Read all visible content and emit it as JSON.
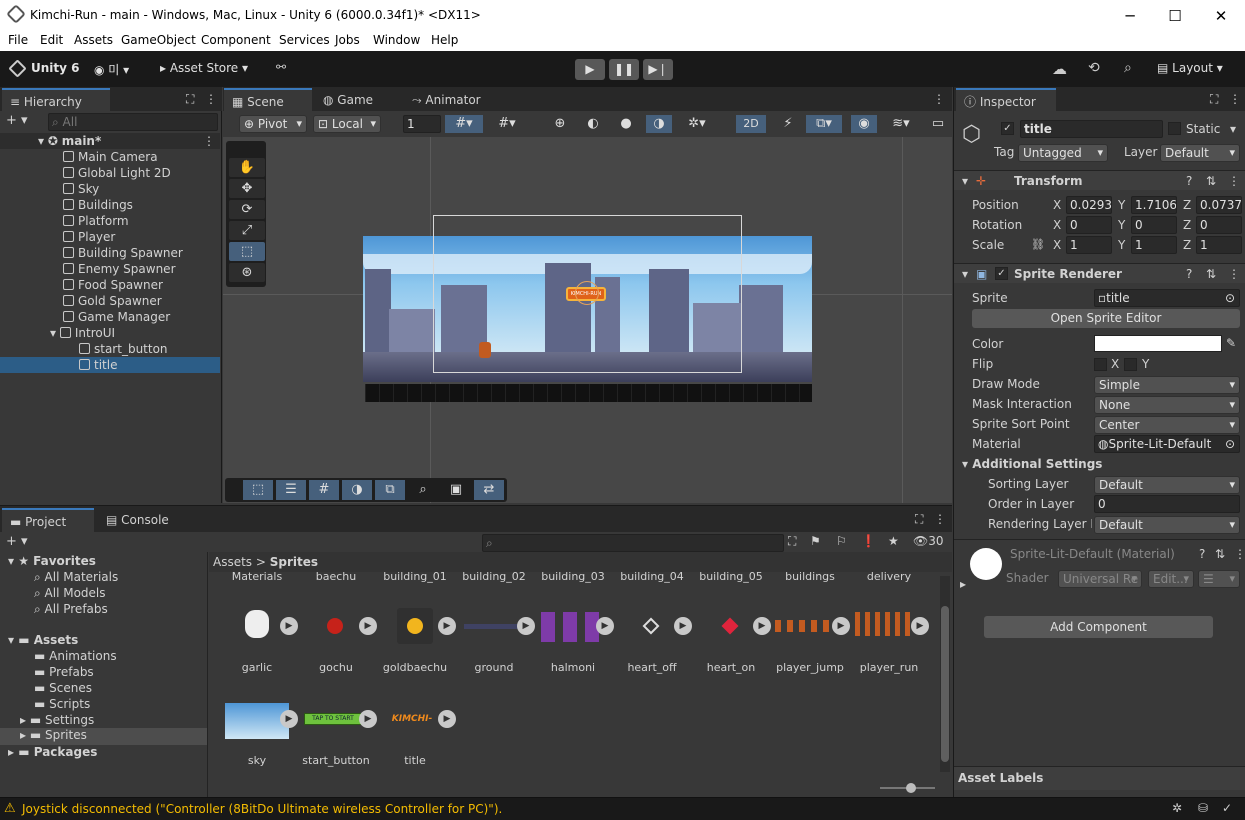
{
  "window": {
    "title": "Kimchi-Run - main - Windows, Mac, Linux - Unity 6 (6000.0.34f1)* <DX11>",
    "minimize": "─",
    "maximize": "☐",
    "close": "✕"
  },
  "menu": [
    "File",
    "Edit",
    "Assets",
    "GameObject",
    "Component",
    "Services",
    "Jobs",
    "Window",
    "Help"
  ],
  "toolbar": {
    "brand": "Unity 6",
    "account": "미",
    "asset_store": "Asset Store",
    "layout": "Layout"
  },
  "hierarchy": {
    "tab": "Hierarchy",
    "search_placeholder": "All",
    "scene": "main*",
    "items": [
      "Main Camera",
      "Global Light 2D",
      "Sky",
      "Buildings",
      "Platform",
      "Player",
      "Building Spawner",
      "Enemy Spawner",
      "Food Spawner",
      "Gold Spawner",
      "Game Manager",
      "IntroUI",
      "start_button",
      "title"
    ]
  },
  "scene": {
    "tabs": [
      "Scene",
      "Game",
      "Animator"
    ],
    "pivot": "Pivot",
    "local": "Local",
    "grid_value": "1",
    "mode_2d": "2D",
    "title_sprite_text": "KIMCHI-RUN"
  },
  "project": {
    "tabs": [
      "Project",
      "Console"
    ],
    "breadcrumb_root": "Assets",
    "breadcrumb_current": "Sprites",
    "count": "30",
    "favorites_label": "Favorites",
    "favorites": [
      "All Materials",
      "All Models",
      "All Prefabs"
    ],
    "assets_label": "Assets",
    "folders": [
      "Animations",
      "Prefabs",
      "Scenes",
      "Scripts",
      "Settings",
      "Sprites"
    ],
    "packages_label": "Packages",
    "top_row": [
      "Materials",
      "baechu",
      "building_01",
      "building_02",
      "building_03",
      "building_04",
      "building_05",
      "buildings",
      "delivery"
    ],
    "row1": [
      "garlic",
      "gochu",
      "goldbaechu",
      "ground",
      "halmoni",
      "heart_off",
      "heart_on",
      "player_jump",
      "player_run"
    ],
    "row2": [
      "sky",
      "start_button",
      "title"
    ],
    "start_button_text": "TAP TO START",
    "title_text": "KIMCHI-RUN"
  },
  "inspector": {
    "tab": "Inspector",
    "name": "title",
    "static": "Static",
    "tag_label": "Tag",
    "tag": "Untagged",
    "layer_label": "Layer",
    "layer": "Default",
    "transform": {
      "title": "Transform",
      "position_label": "Position",
      "rotation_label": "Rotation",
      "scale_label": "Scale",
      "position": [
        "0.0293",
        "1.71062",
        "0.0737"
      ],
      "rotation": [
        "0",
        "0",
        "0"
      ],
      "scale": [
        "1",
        "1",
        "1"
      ]
    },
    "sprite_renderer": {
      "title": "Sprite Renderer",
      "sprite_label": "Sprite",
      "sprite": "title",
      "open_editor": "Open Sprite Editor",
      "color_label": "Color",
      "color": "#ffffff",
      "flip_label": "Flip",
      "flip_x": "X",
      "flip_y": "Y",
      "draw_mode_label": "Draw Mode",
      "draw_mode": "Simple",
      "mask_label": "Mask Interaction",
      "mask": "None",
      "sort_point_label": "Sprite Sort Point",
      "sort_point": "Center",
      "material_label": "Material",
      "material": "Sprite-Lit-Default",
      "additional": "Additional Settings",
      "sorting_layer_label": "Sorting Layer",
      "sorting_layer": "Default",
      "order_label": "Order in Layer",
      "order": "0",
      "rendering_layer_label": "Rendering Layer M",
      "rendering_layer": "Default"
    },
    "material": {
      "name": "Sprite-Lit-Default (Material)",
      "shader_label": "Shader",
      "shader": "Universal Re",
      "edit": "Edit..."
    },
    "add_component": "Add Component",
    "asset_labels": "Asset Labels"
  },
  "status": {
    "message": "Joystick disconnected (\"Controller (8BitDo Ultimate wireless Controller for PC)\")."
  },
  "colors": {
    "accent": "#2c5d87",
    "selection": "#2c5d87",
    "warning": "#f4bc02"
  }
}
